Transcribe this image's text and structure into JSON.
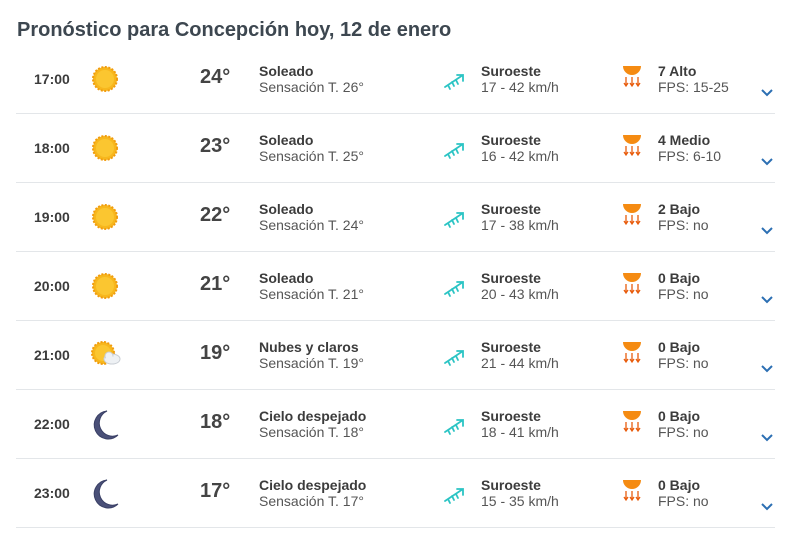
{
  "page": {
    "title": "Pronóstico para Concepción hoy, 12 de enero"
  },
  "colors": {
    "sun": "#f7b71d",
    "moon": "#4a5078",
    "wind_arrow": "#2bc4c4",
    "uv_orange": "#f58b12",
    "chevron": "#2c6fb3"
  },
  "rows": [
    {
      "hour": "17:00",
      "icon": "sun-icon",
      "temp": "24°",
      "sky": "Soleado",
      "feels": "Sensación T. 26°",
      "wind_dir": "Suroeste",
      "wind_speed": "17 - 42 km/h",
      "uv": "7 Alto",
      "fps": "FPS: 15-25"
    },
    {
      "hour": "18:00",
      "icon": "sun-icon",
      "temp": "23°",
      "sky": "Soleado",
      "feels": "Sensación T. 25°",
      "wind_dir": "Suroeste",
      "wind_speed": "16 - 42 km/h",
      "uv": "4 Medio",
      "fps": "FPS: 6-10"
    },
    {
      "hour": "19:00",
      "icon": "sun-icon",
      "temp": "22°",
      "sky": "Soleado",
      "feels": "Sensación T. 24°",
      "wind_dir": "Suroeste",
      "wind_speed": "17 - 38 km/h",
      "uv": "2 Bajo",
      "fps": "FPS: no"
    },
    {
      "hour": "20:00",
      "icon": "sun-icon",
      "temp": "21°",
      "sky": "Soleado",
      "feels": "Sensación T. 21°",
      "wind_dir": "Suroeste",
      "wind_speed": "20 - 43 km/h",
      "uv": "0 Bajo",
      "fps": "FPS: no"
    },
    {
      "hour": "21:00",
      "icon": "sun-cloud-icon",
      "temp": "19°",
      "sky": "Nubes y claros",
      "feels": "Sensación T. 19°",
      "wind_dir": "Suroeste",
      "wind_speed": "21 - 44 km/h",
      "uv": "0 Bajo",
      "fps": "FPS: no"
    },
    {
      "hour": "22:00",
      "icon": "moon-icon",
      "temp": "18°",
      "sky": "Cielo despejado",
      "feels": "Sensación T. 18°",
      "wind_dir": "Suroeste",
      "wind_speed": "18 - 41 km/h",
      "uv": "0 Bajo",
      "fps": "FPS: no"
    },
    {
      "hour": "23:00",
      "icon": "moon-icon",
      "temp": "17°",
      "sky": "Cielo despejado",
      "feels": "Sensación T. 17°",
      "wind_dir": "Suroeste",
      "wind_speed": "15 - 35 km/h",
      "uv": "0 Bajo",
      "fps": "FPS: no"
    }
  ]
}
